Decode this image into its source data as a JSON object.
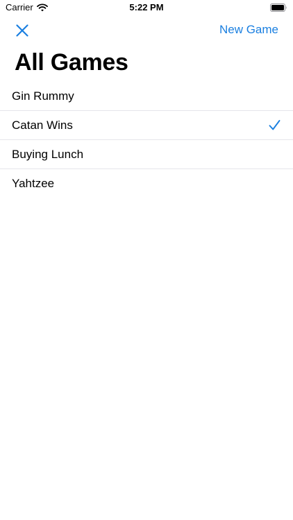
{
  "status_bar": {
    "carrier": "Carrier",
    "time": "5:22 PM",
    "wifi_icon": "wifi-icon",
    "battery_icon": "battery-full-icon"
  },
  "nav": {
    "close_icon": "close-icon",
    "new_game_label": "New Game"
  },
  "title": "All Games",
  "games": [
    {
      "label": "Gin Rummy",
      "selected": false
    },
    {
      "label": "Catan Wins",
      "selected": true
    },
    {
      "label": "Buying Lunch",
      "selected": false
    },
    {
      "label": "Yahtzee",
      "selected": false
    }
  ],
  "colors": {
    "accent": "#1a7fe0",
    "separator": "#e5e5ea",
    "background": "#ffffff",
    "text": "#000000"
  },
  "selected_icon": "checkmark-icon"
}
